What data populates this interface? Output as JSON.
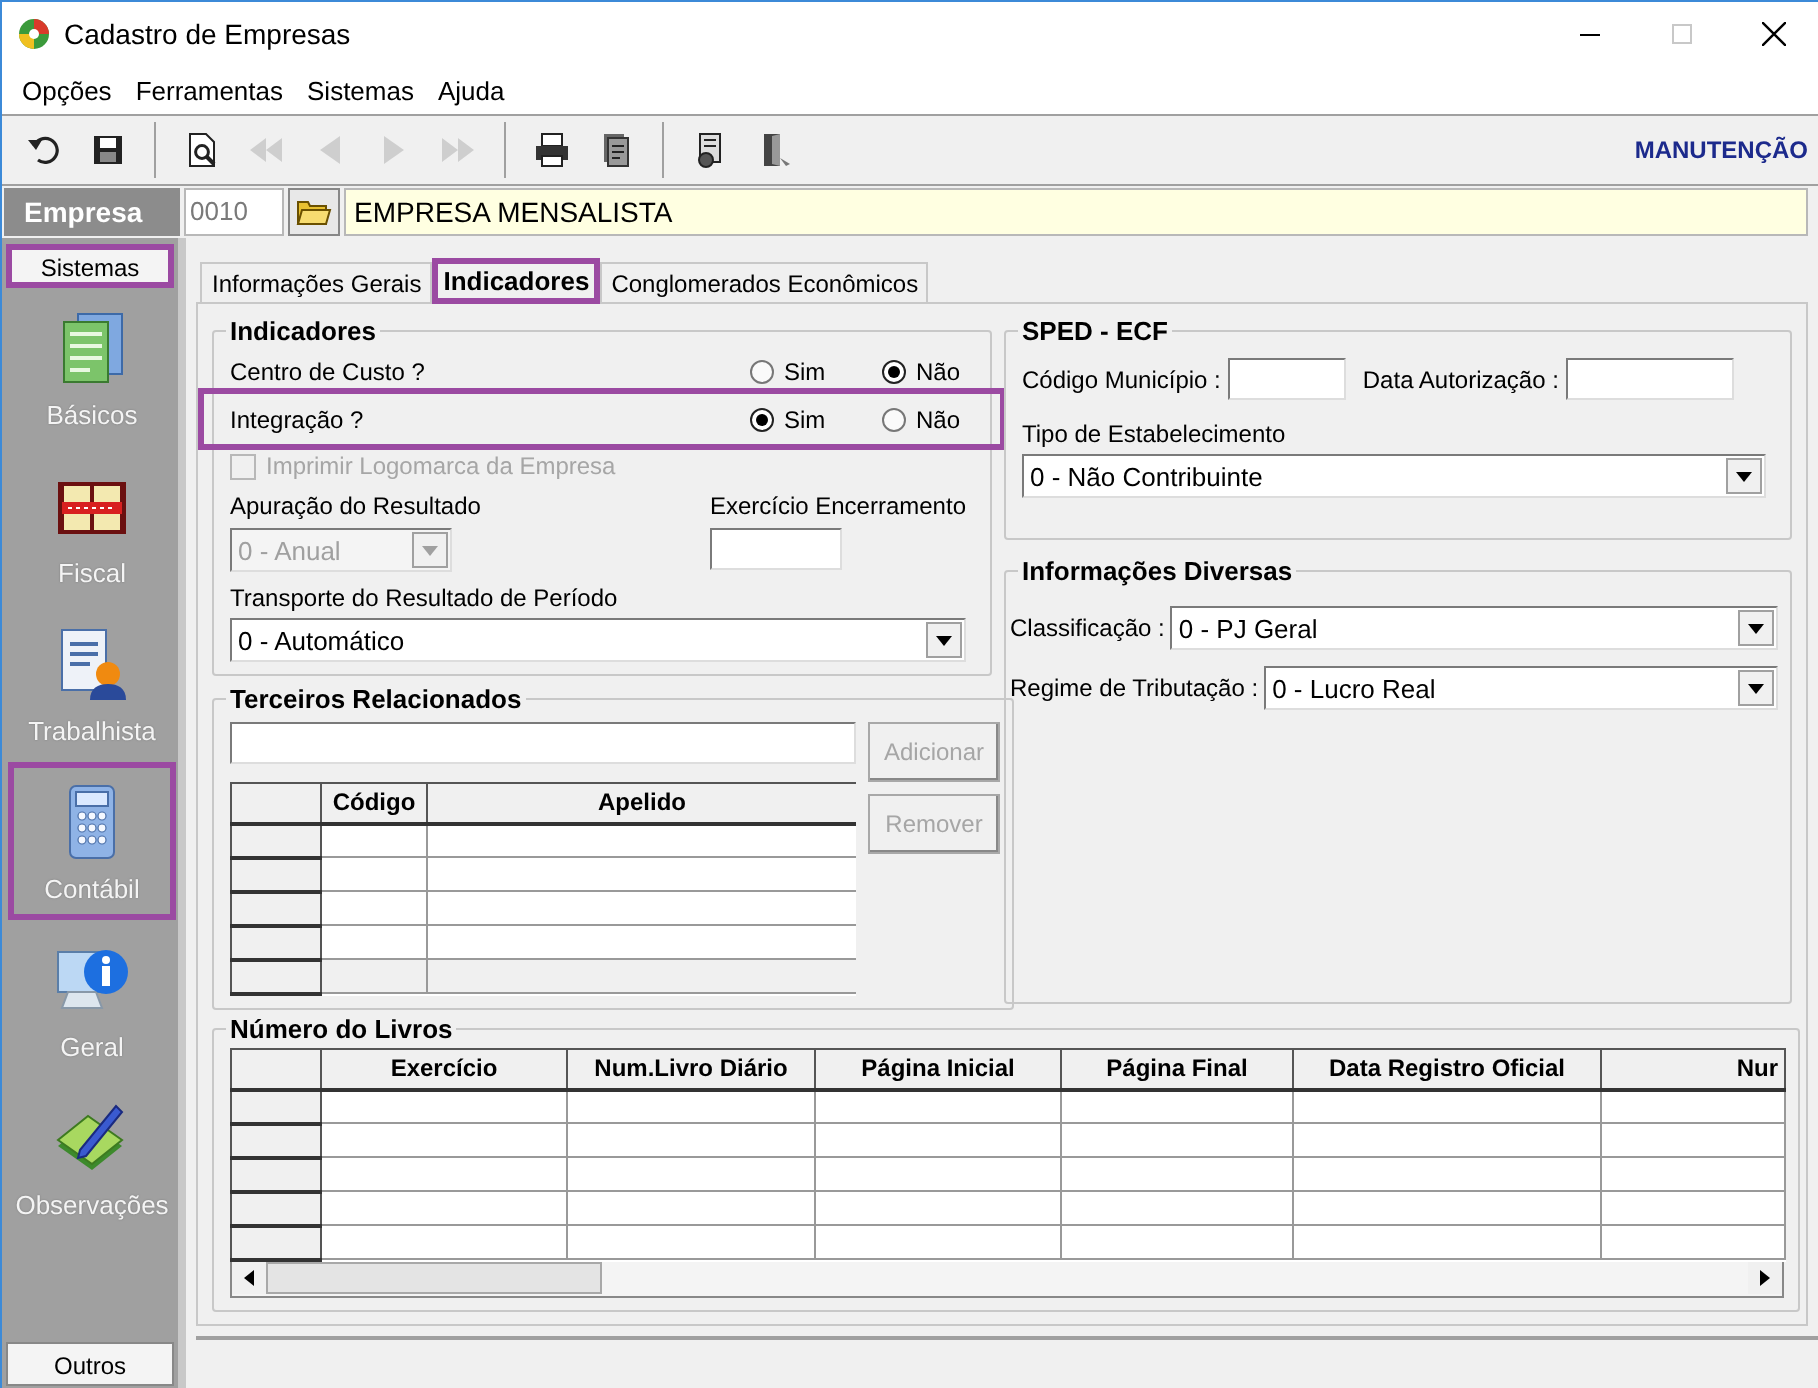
{
  "window": {
    "title": "Cadastro de Empresas"
  },
  "menu": [
    "Opções",
    "Ferramentas",
    "Sistemas",
    "Ajuda"
  ],
  "toolbar": {
    "buttons": [
      {
        "kind": "undo",
        "disabled": false
      },
      {
        "kind": "save",
        "disabled": false
      },
      {
        "kind": "separator"
      },
      {
        "kind": "preview",
        "disabled": false
      },
      {
        "kind": "first",
        "disabled": true
      },
      {
        "kind": "previous",
        "disabled": true
      },
      {
        "kind": "next",
        "disabled": true
      },
      {
        "kind": "last",
        "disabled": true
      },
      {
        "kind": "separator"
      },
      {
        "kind": "print",
        "disabled": false
      },
      {
        "kind": "report",
        "disabled": false
      },
      {
        "kind": "separator"
      },
      {
        "kind": "document",
        "disabled": false
      },
      {
        "kind": "exit",
        "disabled": false
      }
    ],
    "mode": "MANUTENÇÃO"
  },
  "company": {
    "label": "Empresa",
    "code": "0010",
    "name": "EMPRESA MENSALISTA"
  },
  "sidebar": {
    "header": {
      "label": "Sistemas",
      "highlighted": true
    },
    "items": [
      {
        "label": "Básicos",
        "kind": "form",
        "highlighted": false
      },
      {
        "label": "Fiscal",
        "kind": "book",
        "highlighted": false
      },
      {
        "label": "Trabalhista",
        "kind": "person",
        "highlighted": false
      },
      {
        "label": "Contábil",
        "kind": "calculator",
        "highlighted": true
      },
      {
        "label": "Geral",
        "kind": "info",
        "highlighted": false
      },
      {
        "label": "Observações",
        "kind": "notes",
        "highlighted": false
      }
    ],
    "footer": "Outros"
  },
  "tabs": [
    {
      "label": "Informações Gerais",
      "selected": false,
      "highlighted": false
    },
    {
      "label": "Indicadores",
      "selected": true,
      "highlighted": true
    },
    {
      "label": "Conglomerados Econômicos",
      "selected": false,
      "highlighted": false
    }
  ],
  "indicadores": {
    "title": "Indicadores",
    "rows": [
      {
        "label": "Centro de Custo ?",
        "highlighted": false,
        "options": [
          {
            "label": "Sim",
            "selected": false
          },
          {
            "label": "Não",
            "selected": true
          }
        ]
      },
      {
        "label": "Integração ?",
        "highlighted": true,
        "options": [
          {
            "label": "Sim",
            "selected": true
          },
          {
            "label": "Não",
            "selected": false
          }
        ]
      }
    ],
    "checkbox": {
      "label": "Imprimir Logomarca da Empresa",
      "checked": false,
      "disabled": true
    },
    "apuracao": {
      "label": "Apuração do Resultado",
      "value": "0 - Anual",
      "disabled": true
    },
    "exercicio": {
      "label": "Exercício Encerramento"
    },
    "transporte": {
      "label": "Transporte do Resultado de Período",
      "value": "0 - Automático",
      "disabled": false
    }
  },
  "terceiros": {
    "title": "Terceiros Relacionados",
    "buttons": [
      {
        "label": "Adicionar",
        "disabled": true
      },
      {
        "label": "Remover",
        "disabled": true
      }
    ],
    "columns": [
      "Código",
      "Apelido"
    ]
  },
  "sped_ecf": {
    "title": "SPED - ECF",
    "codigo_municipio": {
      "label": "Código Município :"
    },
    "data_autorizacao": {
      "label": "Data Autorização :"
    },
    "tipo": {
      "label": "Tipo de Estabelecimento",
      "value": "0 - Não Contribuinte",
      "disabled": false
    }
  },
  "informacoes_diversas": {
    "title": "Informações Diversas",
    "fields": [
      {
        "label": "Classificação :",
        "value": "0 - PJ Geral",
        "disabled": false
      },
      {
        "label": "Regime de Tributação :",
        "value": "0 - Lucro Real",
        "disabled": false
      }
    ]
  },
  "livros": {
    "title": "Número do Livros",
    "columns": [
      "Exercício",
      "Num.Livro Diário",
      "Página Inicial",
      "Página Final",
      "Data Registro Oficial",
      "Nur"
    ]
  }
}
